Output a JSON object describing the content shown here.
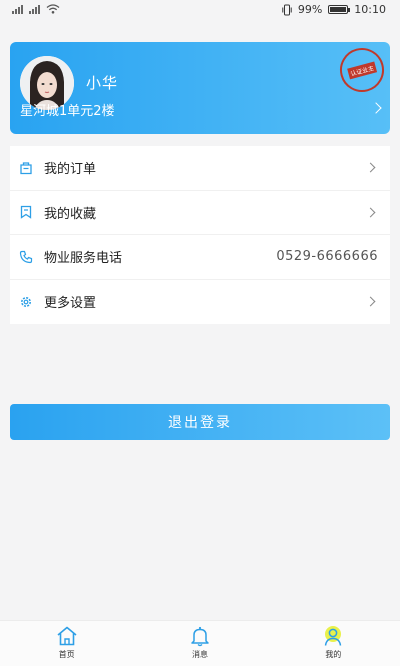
{
  "status_bar": {
    "battery": "99%",
    "time": "10:10",
    "battery_level": 0.99
  },
  "profile": {
    "name": "小华",
    "address": "星河城1单元2楼",
    "stamp_text": "认证业主"
  },
  "menu": {
    "items": [
      {
        "label": "我的订单",
        "icon": "order-icon"
      },
      {
        "label": "我的收藏",
        "icon": "bookmark-icon"
      },
      {
        "label": "物业服务电话",
        "value": "0529-6666666",
        "icon": "phone-icon"
      },
      {
        "label": "更多设置",
        "icon": "gear-icon"
      }
    ]
  },
  "logout_label": "退出登录",
  "tabbar": {
    "tabs": [
      {
        "label": "首页",
        "icon": "home-icon"
      },
      {
        "label": "消息",
        "icon": "bell-icon"
      },
      {
        "label": "我的",
        "icon": "user-icon",
        "active": true
      }
    ]
  },
  "colors": {
    "accent": "#29a3f1",
    "accent_light": "#57bff7",
    "icon_blue": "#2d9fe6"
  }
}
